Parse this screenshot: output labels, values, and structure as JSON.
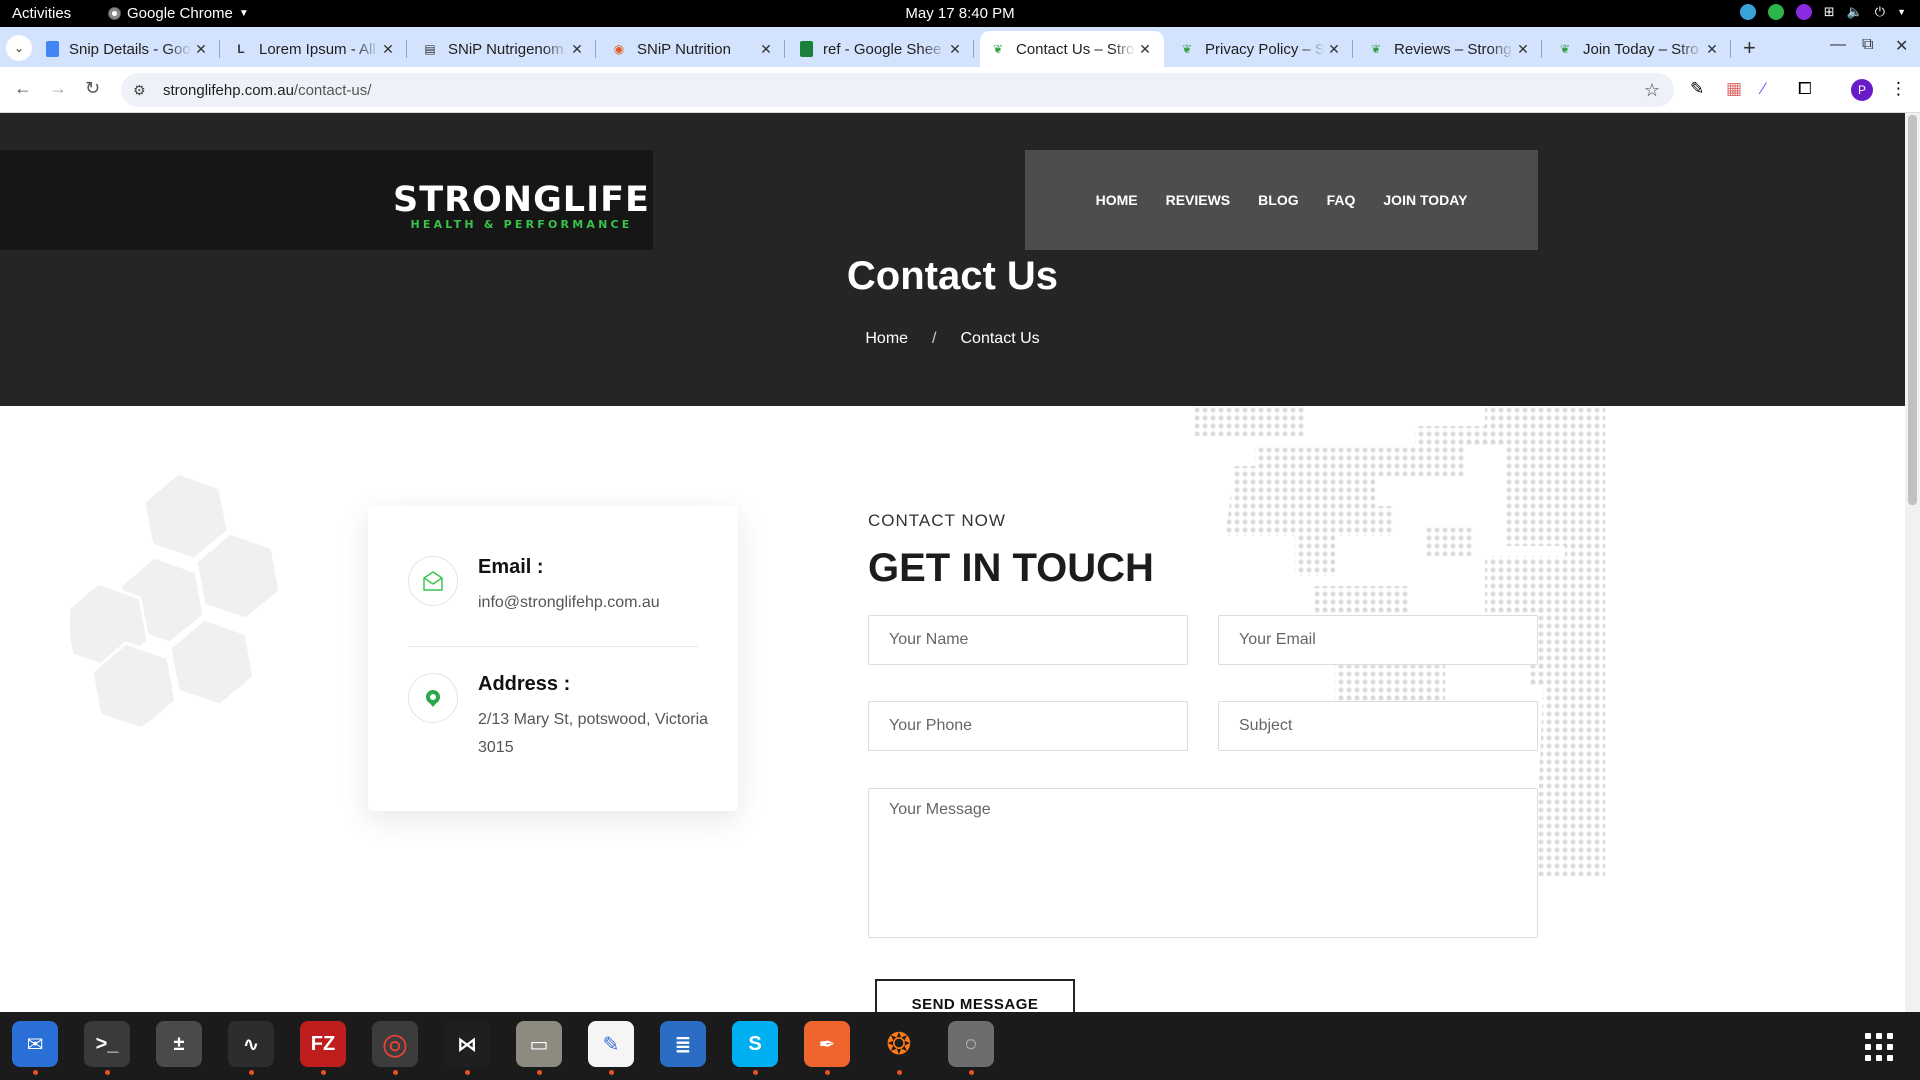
{
  "system": {
    "activities": "Activities",
    "app_name": "Google Chrome",
    "clock": "May 17  8:40 PM"
  },
  "browser": {
    "tabs": [
      {
        "title": "Snip Details - Goo",
        "icon": "docs-icon",
        "color": "#4285f4"
      },
      {
        "title": "Lorem Ipsum - All",
        "icon": "lorem-icon",
        "color": "#333333"
      },
      {
        "title": "SNiP Nutrigenom",
        "icon": "snip-icon",
        "color": "#333333"
      },
      {
        "title": "SNiP Nutrition",
        "icon": "snip-nutrition-icon",
        "color": "#e05a2a"
      },
      {
        "title": "ref - Google Shee",
        "icon": "sheets-icon",
        "color": "#188038"
      },
      {
        "title": "Contact Us – Stro",
        "icon": "stronglife-icon",
        "color": "#38a04a",
        "active": true
      },
      {
        "title": "Privacy Policy – St",
        "icon": "stronglife-icon",
        "color": "#38a04a"
      },
      {
        "title": "Reviews – Strong",
        "icon": "stronglife-icon",
        "color": "#38a04a"
      },
      {
        "title": "Join Today – Stro",
        "icon": "stronglife-icon",
        "color": "#38a04a"
      }
    ],
    "url_host": "stronglifehp.com.au",
    "url_path": "/contact-us/",
    "profile_initial": "P"
  },
  "site": {
    "logo_main": "STRONGLIFE",
    "logo_sub": "HEALTH & PERFORMANCE",
    "nav": [
      "HOME",
      "REVIEWS",
      "BLOG",
      "FAQ",
      "JOIN TODAY"
    ],
    "page_title": "Contact Us",
    "breadcrumb": {
      "home": "Home",
      "separator": "/",
      "current": "Contact Us"
    },
    "contact_card": {
      "email_label": "Email :",
      "email_value": "info@stronglifehp.com.au",
      "address_label": "Address :",
      "address_value": "2/13 Mary St, potswood, Victoria 3015"
    },
    "form": {
      "eyebrow": "CONTACT NOW",
      "heading": "GET IN TOUCH",
      "name_placeholder": "Your Name",
      "email_placeholder": "Your Email",
      "phone_placeholder": "Your Phone",
      "subject_placeholder": "Subject",
      "message_placeholder": "Your Message",
      "send_label": "SEND MESSAGE"
    }
  },
  "colors": {
    "hero_bg": "#252525",
    "brand_green": "#38c34a",
    "tab_strip": "#d3e3fd"
  },
  "dock": [
    {
      "name": "thunderbird-icon",
      "color": "#2a6fd6",
      "running": true
    },
    {
      "name": "terminal-icon",
      "color": "#3a3a3a",
      "running": true
    },
    {
      "name": "calculator-icon",
      "color": "#4a4a4a",
      "running": false
    },
    {
      "name": "system-monitor-icon",
      "color": "#2d2d2d",
      "running": true
    },
    {
      "name": "filezilla-icon",
      "color": "#bf1e1e",
      "running": true
    },
    {
      "name": "chrome-icon",
      "color": "#3c3c3c",
      "running": true
    },
    {
      "name": "vscode-icon",
      "color": "#1f1f1f",
      "running": true
    },
    {
      "name": "files-icon",
      "color": "#8d8a80",
      "running": true
    },
    {
      "name": "text-editor-icon",
      "color": "#f5f5f5",
      "running": true
    },
    {
      "name": "writer-icon",
      "color": "#2b6cc4",
      "running": false
    },
    {
      "name": "skype-icon",
      "color": "#00aff0",
      "running": true
    },
    {
      "name": "inkscape-icon",
      "color": "#f0642d",
      "running": true
    },
    {
      "name": "firefox-dev-icon",
      "color": "#1b1b1b",
      "running": true
    },
    {
      "name": "disk-icon",
      "color": "#6c6c6c",
      "running": true
    }
  ]
}
